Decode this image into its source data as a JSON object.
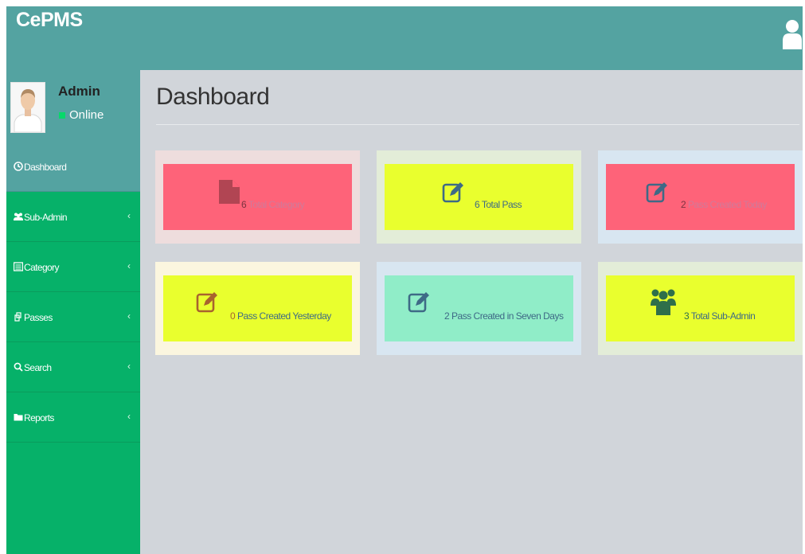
{
  "app": {
    "brand": "CePMS"
  },
  "profile": {
    "name": "Admin",
    "status": "Online"
  },
  "sidebar": {
    "items": [
      {
        "label": "Dashboard",
        "icon": "dashboard-icon"
      },
      {
        "label": "Sub-Admin",
        "icon": "users-icon"
      },
      {
        "label": "Category",
        "icon": "list-alt-icon"
      },
      {
        "label": "Passes",
        "icon": "passes-icon"
      },
      {
        "label": "Search",
        "icon": "search-icon"
      },
      {
        "label": "Reports",
        "icon": "folder-icon"
      }
    ]
  },
  "main": {
    "title": "Dashboard",
    "cards": [
      {
        "count": "6",
        "label": "Total Category",
        "icon": "file-icon"
      },
      {
        "count": "6",
        "label": "Total Pass",
        "icon": "edit-icon"
      },
      {
        "count": "2",
        "label": "Pass Created Today",
        "icon": "edit-icon"
      },
      {
        "count": "0",
        "label": "Pass Created Yesterday",
        "icon": "edit-icon"
      },
      {
        "count": "2",
        "label": "Pass Created in Seven Days",
        "icon": "edit-icon"
      },
      {
        "count": "3",
        "label": "Total Sub-Admin",
        "icon": "users-icon"
      }
    ]
  },
  "colors": {
    "topbar": "#54a3a1",
    "sidebar": "#06b169",
    "content_bg": "#d1d5da",
    "pink": "#fe6379",
    "yellow": "#e9ff2e",
    "mint": "#90edc8"
  }
}
